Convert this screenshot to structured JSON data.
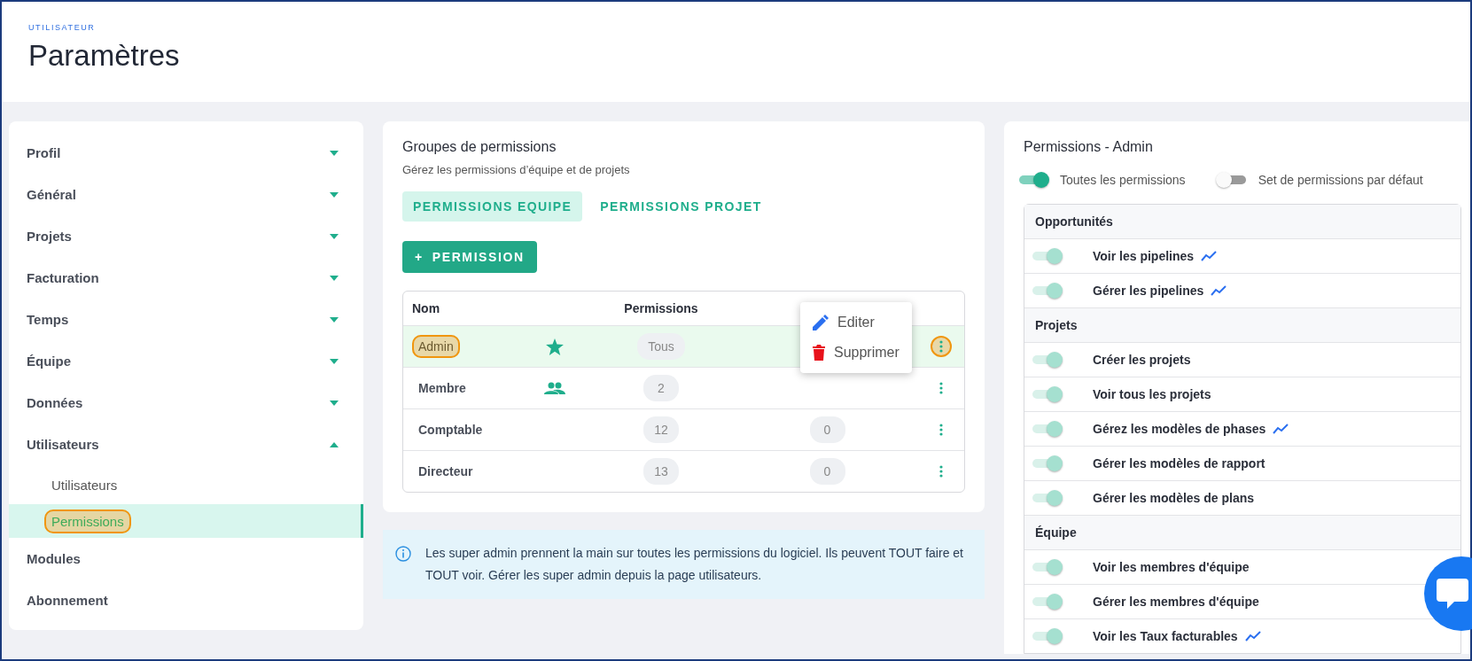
{
  "header": {
    "breadcrumb": "UTILISATEUR",
    "title": "Paramètres"
  },
  "sidebar": {
    "items": [
      {
        "label": "Profil",
        "expanded": false
      },
      {
        "label": "Général",
        "expanded": false
      },
      {
        "label": "Projets",
        "expanded": false
      },
      {
        "label": "Facturation",
        "expanded": false
      },
      {
        "label": "Temps",
        "expanded": false
      },
      {
        "label": "Équipe",
        "expanded": false
      },
      {
        "label": "Données",
        "expanded": false
      },
      {
        "label": "Utilisateurs",
        "expanded": true,
        "children": [
          {
            "label": "Utilisateurs",
            "selected": false,
            "highlighted": false
          },
          {
            "label": "Permissions",
            "selected": true,
            "highlighted": true
          }
        ]
      },
      {
        "label": "Modules"
      },
      {
        "label": "Abonnement"
      }
    ]
  },
  "groups": {
    "title": "Groupes de permissions",
    "subtitle": "Gérez les permissions d’équipe et de projets",
    "tabs": [
      {
        "label": "PERMISSIONS EQUIPE",
        "selected": true
      },
      {
        "label": "PERMISSIONS PROJET",
        "selected": false
      }
    ],
    "add_button": {
      "icon": "+",
      "label": "PERMISSION"
    },
    "table": {
      "columns": [
        "Nom",
        "Permissions"
      ],
      "rows": [
        {
          "name": "Admin",
          "kind": "default",
          "permissions": "Tous",
          "selected": true,
          "highlighted": true
        },
        {
          "name": "Membre",
          "kind": "team",
          "permissions": "2",
          "selected": false,
          "highlighted": false
        },
        {
          "name": "Comptable",
          "kind": "custom",
          "permissions": "12",
          "users": "0",
          "selected": false,
          "highlighted": false
        },
        {
          "name": "Directeur",
          "kind": "custom",
          "permissions": "13",
          "users": "0",
          "selected": false,
          "highlighted": false
        }
      ]
    },
    "menu": [
      {
        "kind": "edit",
        "label": "Editer"
      },
      {
        "kind": "delete",
        "label": "Supprimer"
      }
    ]
  },
  "info": "Les super admin prennent la main sur toutes les permissions du logiciel. Ils peuvent TOUT faire et TOUT voir. Gérer les super admin depuis la page utilisateurs.",
  "permissions": {
    "title": "Permissions - Admin",
    "switches": [
      {
        "label": "Toutes les permissions",
        "on": true
      },
      {
        "label": "Set de permissions par défaut",
        "on": false
      }
    ],
    "list": [
      {
        "kind": "header",
        "label": "Opportunités"
      },
      {
        "kind": "permission",
        "label": "Voir les pipelines",
        "on": true,
        "trend": true
      },
      {
        "kind": "permission",
        "label": "Gérer les pipelines",
        "on": true,
        "trend": true
      },
      {
        "kind": "header",
        "label": "Projets"
      },
      {
        "kind": "permission",
        "label": "Créer les projets",
        "on": true,
        "trend": false
      },
      {
        "kind": "permission",
        "label": "Voir tous les projets",
        "on": true,
        "trend": false
      },
      {
        "kind": "permission",
        "label": "Gérez les modèles de phases",
        "on": true,
        "trend": true
      },
      {
        "kind": "permission",
        "label": "Gérer les modèles de rapport",
        "on": true,
        "trend": false
      },
      {
        "kind": "permission",
        "label": "Gérer les modèles de plans",
        "on": true,
        "trend": false
      },
      {
        "kind": "header",
        "label": "Équipe"
      },
      {
        "kind": "permission",
        "label": "Voir les membres d'équipe",
        "on": true,
        "trend": false
      },
      {
        "kind": "permission",
        "label": "Gérer les membres d'équipe",
        "on": true,
        "trend": false
      },
      {
        "kind": "permission",
        "label": "Voir les Taux facturables",
        "on": true,
        "trend": true
      }
    ]
  }
}
